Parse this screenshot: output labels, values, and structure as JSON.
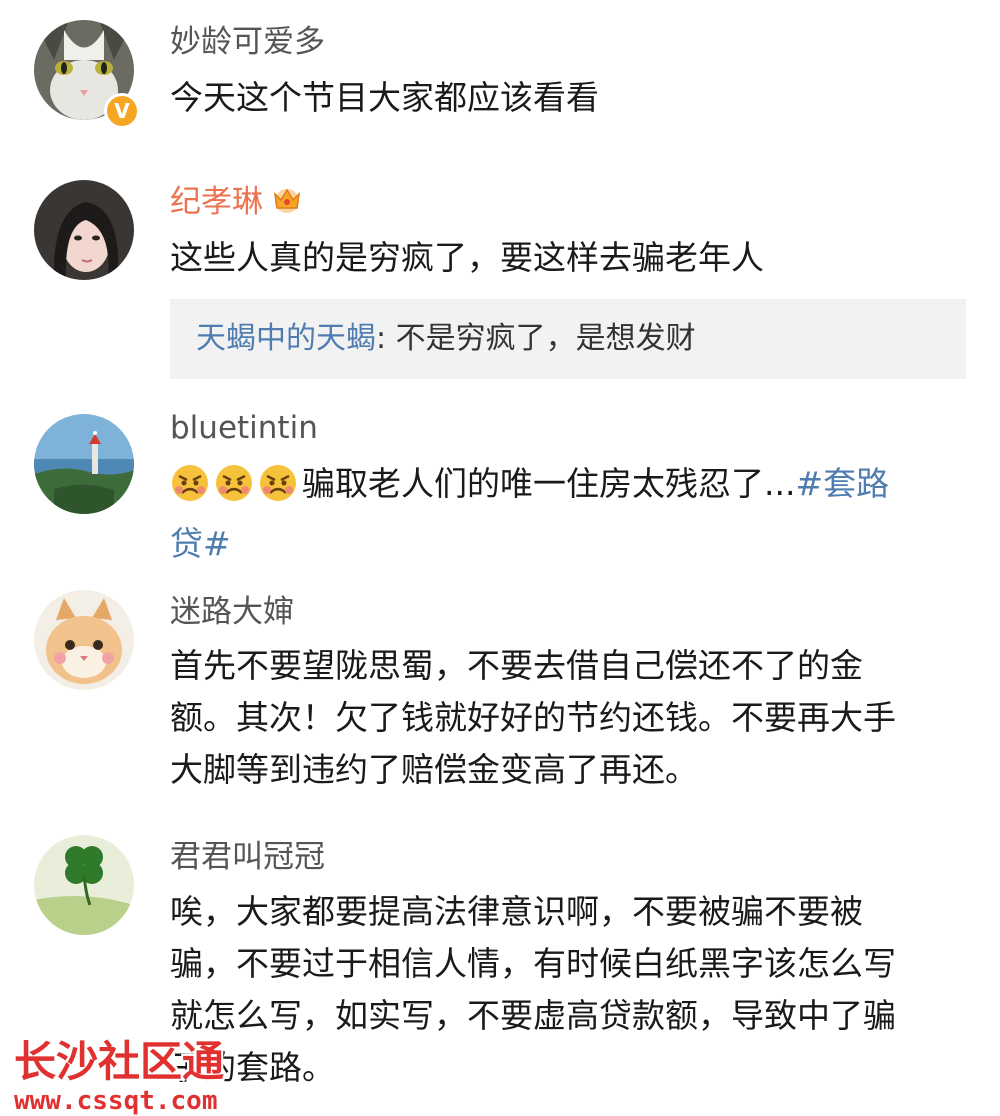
{
  "comments": [
    {
      "username": "妙龄可爱多",
      "verified": true,
      "text": "今天这个节目大家都应该看看"
    },
    {
      "username": "纪孝琳",
      "vip_crown": true,
      "text": "这些人真的是穷疯了，要这样去骗老年人",
      "reply": {
        "user": "天蝎中的天蝎",
        "separator": ":",
        "text": "不是穷疯了，是想发财"
      }
    },
    {
      "username": "bluetintin",
      "emojis": [
        "angry-face-icon",
        "angry-face-icon",
        "angry-face-icon"
      ],
      "text_line1": "骗取老人们的唯一住房太残忍了...",
      "hashtag_part1": "#套路",
      "hashtag_part2": "贷#"
    },
    {
      "username": "迷路大婶",
      "text_lines": [
        "首先不要望陇思蜀，不要去借自己偿还不了的金",
        "额。其次！欠了钱就好好的节约还钱。不要再大手",
        "大脚等到违约了赔偿金变高了再还。"
      ]
    },
    {
      "username": "君君叫冠冠",
      "text_lines": [
        "唉，大家都要提高法律意识啊，不要被骗不要被",
        "骗，不要过于相信人情，有时候白纸黑字该怎么写",
        "就怎么写，如实写，不要虚高贷款额，导致中了骗",
        "子的套路。"
      ]
    }
  ],
  "watermark": {
    "title": "长沙社区通",
    "url": "www.cssqt.com"
  },
  "colors": {
    "username": "#555555",
    "vip_username": "#eb7350",
    "link": "#507daf",
    "reply_bg": "#f2f2f2",
    "watermark": "#e0302f"
  }
}
